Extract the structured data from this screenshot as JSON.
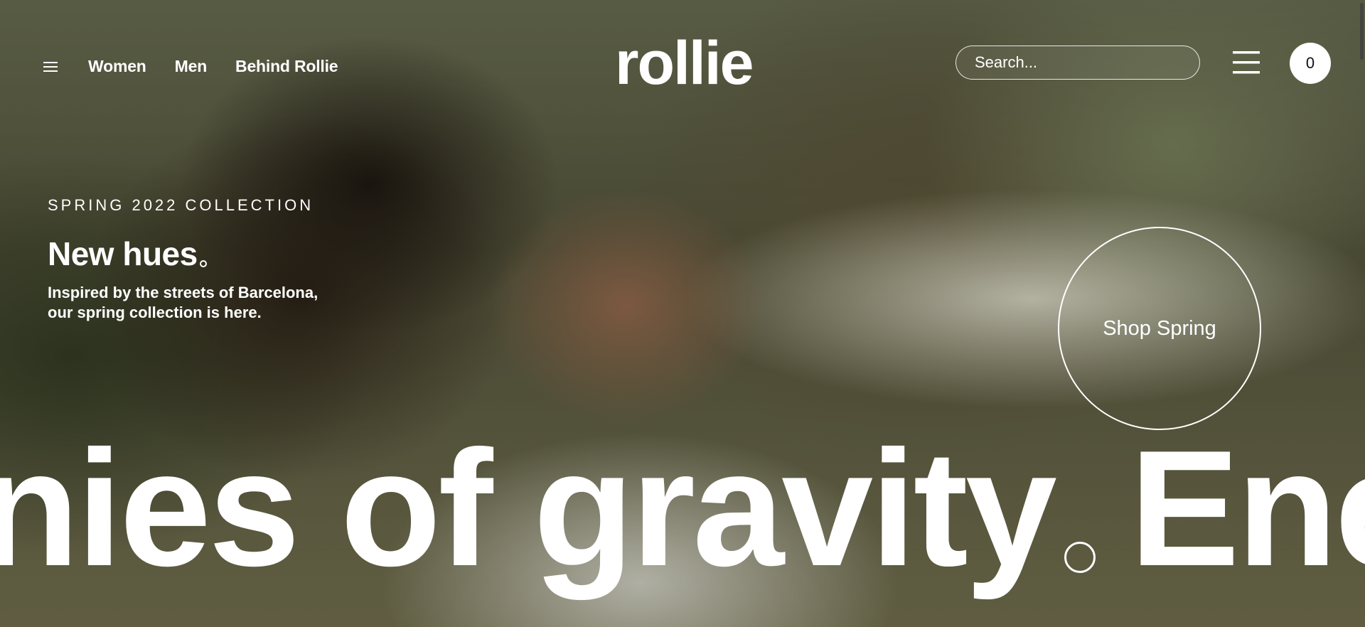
{
  "header": {
    "logo": "rollie",
    "nav": [
      {
        "label": "Women"
      },
      {
        "label": "Men"
      },
      {
        "label": "Behind Rollie"
      }
    ],
    "search": {
      "placeholder": "Search..."
    },
    "cart_count": "0"
  },
  "hero": {
    "eyebrow": "SPRING 2022 COLLECTION",
    "headline": "New hues",
    "subtext_line1": "Inspired by the streets of Barcelona,",
    "subtext_line2": "our spring collection is here.",
    "cta_label": "Shop Spring",
    "marquee_before": "nies of gravity",
    "marquee_after": "Ene"
  },
  "icons": {
    "menu_small": "hamburger-icon",
    "menu_big": "hamburger-icon",
    "cart": "cart-icon"
  },
  "colors": {
    "text": "#ffffff",
    "cart_bg": "#ffffff"
  }
}
